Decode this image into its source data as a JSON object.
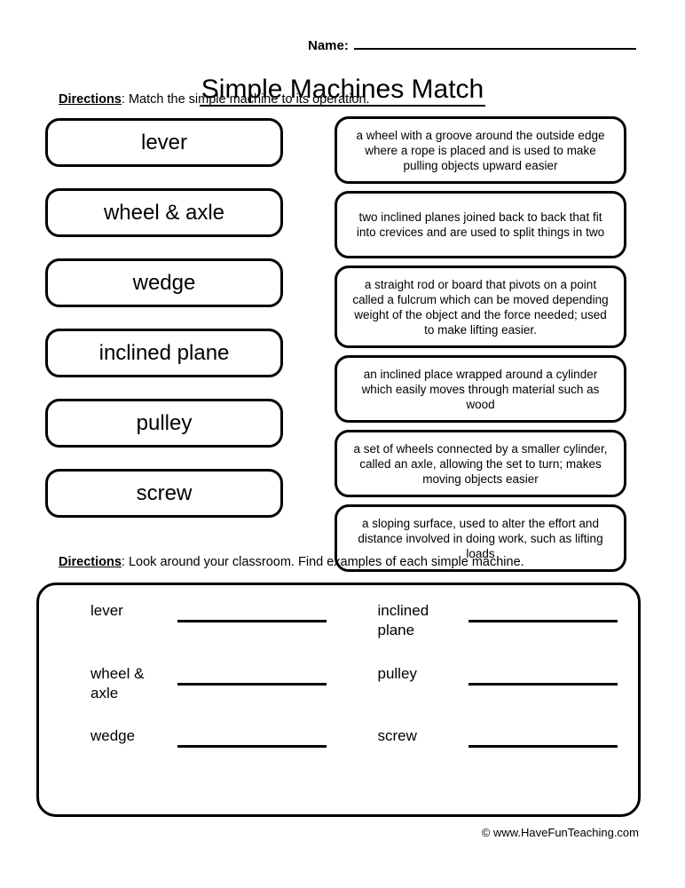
{
  "header": {
    "name_label": "Name:",
    "title": "Simple Machines Match"
  },
  "directions": {
    "word": "Directions",
    "one": ": Match the simple machine to its operation.",
    "two": ": Look around your classroom.  Find examples of each simple machine."
  },
  "match": {
    "terms": [
      {
        "label": "lever"
      },
      {
        "label": "wheel & axle"
      },
      {
        "label": "wedge"
      },
      {
        "label": "inclined plane"
      },
      {
        "label": "pulley"
      },
      {
        "label": "screw"
      }
    ],
    "definitions": [
      {
        "text": "a wheel with a groove around the outside edge where a rope is placed and is used to make pulling objects upward easier",
        "lines": 3
      },
      {
        "text": "two inclined planes joined back to back that fit into crevices and are used to split things in two",
        "lines": 3
      },
      {
        "text": "a straight rod or board that pivots on a point called a fulcrum which can be moved depending weight of the object and the force needed; used to make lifting easier.",
        "lines": 4
      },
      {
        "text": "an inclined place wrapped around a cylinder which easily moves through material such as wood",
        "lines": 3
      },
      {
        "text": "a set of wheels connected by a smaller cylinder, called an axle, allowing the set to turn; makes moving objects easier",
        "lines": 3
      },
      {
        "text": "a sloping surface, used to alter the effort and distance involved in doing work, such as lifting loads",
        "lines": 3
      }
    ]
  },
  "answers": {
    "cells": [
      {
        "label": "lever",
        "value": ""
      },
      {
        "label": "inclined plane",
        "value": ""
      },
      {
        "label": "wheel & axle",
        "value": ""
      },
      {
        "label": "pulley",
        "value": ""
      },
      {
        "label": "wedge",
        "value": ""
      },
      {
        "label": "screw",
        "value": ""
      }
    ]
  },
  "footer": {
    "credit": "© www.HaveFunTeaching.com"
  }
}
